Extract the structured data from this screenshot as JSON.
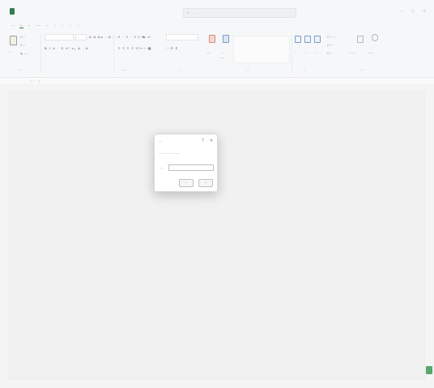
{
  "titlebar": {
    "title": "· · ·  · · ·",
    "search_placeholder": "··  ··",
    "minimize": "—",
    "maximize": "▢",
    "close": "✕"
  },
  "menu": {
    "items": [
      "···",
      "··",
      "··",
      "····",
      "··",
      "··",
      "··",
      "··",
      "··"
    ],
    "active_index": 1
  },
  "ribbon": {
    "clipboard": {
      "paste_label": "··",
      "cut": "□ ··",
      "copy": "□ ··",
      "format_painter": "✎ ····",
      "group_label": "···"
    },
    "font": {
      "size_value": "·",
      "row1": "A A  Aa ·  A·  ···",
      "row2": "B  I  U · S  x² x₂  A · A ·",
      "group_label": "··"
    },
    "paragraph": {
      "row1": "≡ · ≡ · ≡ ·  ↹ ↤",
      "row2": "≡ ≡ ≡ ≡ ≡  ↕ ·  ▦ ·",
      "group_label": "····"
    },
    "styles": {
      "row1": "□ ·····",
      "row2": "□ ····· ·",
      "row3": "··  ·  ¶  ·  ¶",
      "group_label": "··"
    },
    "find": {
      "label_a": "····",
      "label_b": "··",
      "label_c": "····"
    },
    "editing": {
      "group_label": "···",
      "items": [
        "··",
        "··",
        "··"
      ],
      "side": [
        "□ ···· ·",
        "□ ···",
        "□ ··"
      ]
    },
    "extras": {
      "label_a": "······",
      "label_b": "······",
      "group_label": "···"
    }
  },
  "ruler": {
    "text": "· | · · · |"
  },
  "dialog": {
    "title": "···",
    "help": "?",
    "close": "✕",
    "message": "··· ····· ·· ·······",
    "field_label": "···:",
    "field_value": "",
    "ok_label": "··",
    "cancel_label": "··"
  },
  "colors": {
    "accent": "#2f7d4f",
    "canvas": "#f4f4f4",
    "dialog_bg": "#ffffff"
  },
  "icons": [
    "app-icon",
    "search-icon",
    "paste-icon",
    "document-icon"
  ]
}
